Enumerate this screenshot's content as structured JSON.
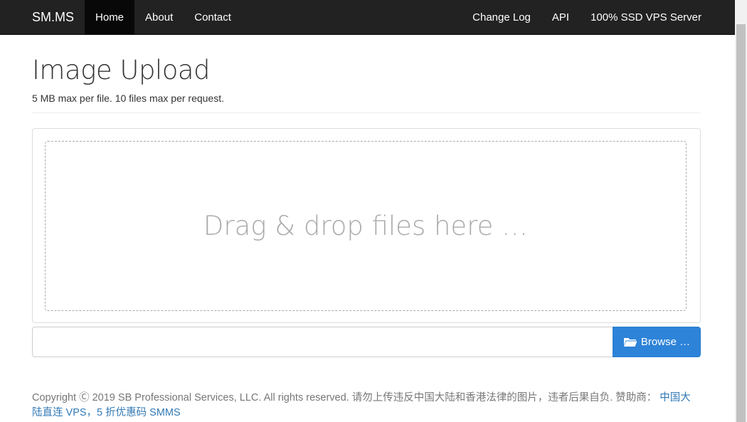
{
  "navbar": {
    "brand": "SM.MS",
    "left_items": [
      {
        "label": "Home",
        "active": true
      },
      {
        "label": "About",
        "active": false
      },
      {
        "label": "Contact",
        "active": false
      }
    ],
    "right_items": [
      {
        "label": "Change Log"
      },
      {
        "label": "API"
      },
      {
        "label": "100% SSD VPS Server"
      }
    ]
  },
  "header": {
    "title": "Image Upload",
    "subtitle": "5 MB max per file. 10 files max per request."
  },
  "upload": {
    "drop_text": "Drag & drop files here …",
    "caption_value": "",
    "browse_label": "Browse …",
    "browse_icon": "folder-open-icon"
  },
  "footer": {
    "copyright": "Copyright Ⓒ 2019 SB Professional Services, LLC. All rights reserved. 请勿上传违反中国大陆和香港法律的图片，违者后果自负. 赞助商： ",
    "sponsor_link": "中国大陆直连 VPS，5 折优惠码 SMMS"
  },
  "colors": {
    "navbar_bg": "#222222",
    "active_nav_bg": "#080808",
    "primary_button": "#2d83d8",
    "link": "#337ab7"
  }
}
